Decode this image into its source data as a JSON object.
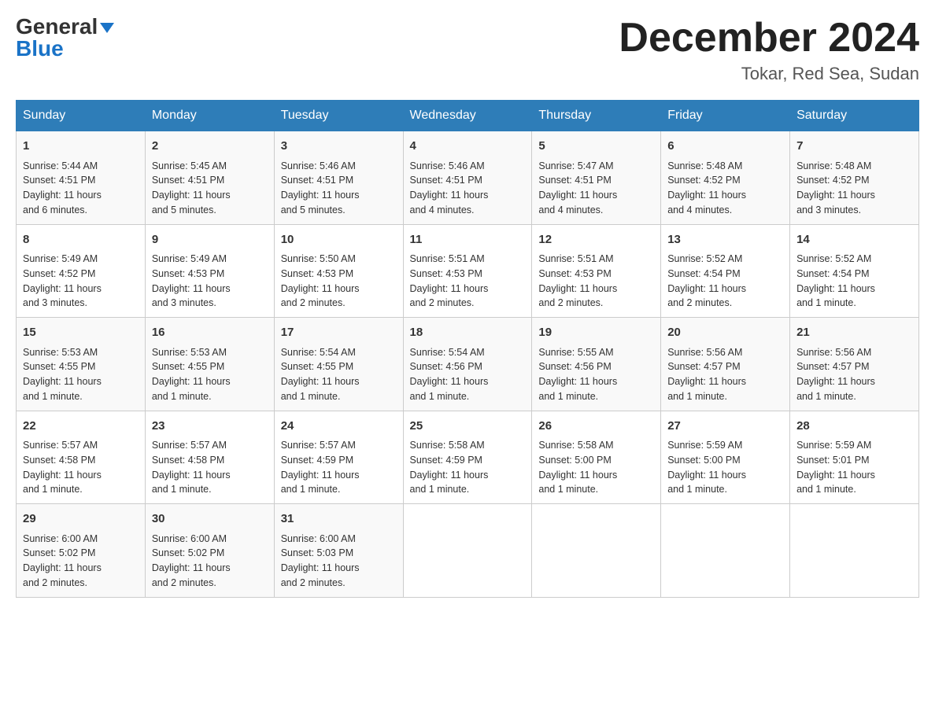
{
  "logo": {
    "general": "General",
    "blue": "Blue"
  },
  "title": {
    "month_year": "December 2024",
    "location": "Tokar, Red Sea, Sudan"
  },
  "headers": [
    "Sunday",
    "Monday",
    "Tuesday",
    "Wednesday",
    "Thursday",
    "Friday",
    "Saturday"
  ],
  "weeks": [
    [
      {
        "day": "1",
        "info": "Sunrise: 5:44 AM\nSunset: 4:51 PM\nDaylight: 11 hours\nand 6 minutes."
      },
      {
        "day": "2",
        "info": "Sunrise: 5:45 AM\nSunset: 4:51 PM\nDaylight: 11 hours\nand 5 minutes."
      },
      {
        "day": "3",
        "info": "Sunrise: 5:46 AM\nSunset: 4:51 PM\nDaylight: 11 hours\nand 5 minutes."
      },
      {
        "day": "4",
        "info": "Sunrise: 5:46 AM\nSunset: 4:51 PM\nDaylight: 11 hours\nand 4 minutes."
      },
      {
        "day": "5",
        "info": "Sunrise: 5:47 AM\nSunset: 4:51 PM\nDaylight: 11 hours\nand 4 minutes."
      },
      {
        "day": "6",
        "info": "Sunrise: 5:48 AM\nSunset: 4:52 PM\nDaylight: 11 hours\nand 4 minutes."
      },
      {
        "day": "7",
        "info": "Sunrise: 5:48 AM\nSunset: 4:52 PM\nDaylight: 11 hours\nand 3 minutes."
      }
    ],
    [
      {
        "day": "8",
        "info": "Sunrise: 5:49 AM\nSunset: 4:52 PM\nDaylight: 11 hours\nand 3 minutes."
      },
      {
        "day": "9",
        "info": "Sunrise: 5:49 AM\nSunset: 4:53 PM\nDaylight: 11 hours\nand 3 minutes."
      },
      {
        "day": "10",
        "info": "Sunrise: 5:50 AM\nSunset: 4:53 PM\nDaylight: 11 hours\nand 2 minutes."
      },
      {
        "day": "11",
        "info": "Sunrise: 5:51 AM\nSunset: 4:53 PM\nDaylight: 11 hours\nand 2 minutes."
      },
      {
        "day": "12",
        "info": "Sunrise: 5:51 AM\nSunset: 4:53 PM\nDaylight: 11 hours\nand 2 minutes."
      },
      {
        "day": "13",
        "info": "Sunrise: 5:52 AM\nSunset: 4:54 PM\nDaylight: 11 hours\nand 2 minutes."
      },
      {
        "day": "14",
        "info": "Sunrise: 5:52 AM\nSunset: 4:54 PM\nDaylight: 11 hours\nand 1 minute."
      }
    ],
    [
      {
        "day": "15",
        "info": "Sunrise: 5:53 AM\nSunset: 4:55 PM\nDaylight: 11 hours\nand 1 minute."
      },
      {
        "day": "16",
        "info": "Sunrise: 5:53 AM\nSunset: 4:55 PM\nDaylight: 11 hours\nand 1 minute."
      },
      {
        "day": "17",
        "info": "Sunrise: 5:54 AM\nSunset: 4:55 PM\nDaylight: 11 hours\nand 1 minute."
      },
      {
        "day": "18",
        "info": "Sunrise: 5:54 AM\nSunset: 4:56 PM\nDaylight: 11 hours\nand 1 minute."
      },
      {
        "day": "19",
        "info": "Sunrise: 5:55 AM\nSunset: 4:56 PM\nDaylight: 11 hours\nand 1 minute."
      },
      {
        "day": "20",
        "info": "Sunrise: 5:56 AM\nSunset: 4:57 PM\nDaylight: 11 hours\nand 1 minute."
      },
      {
        "day": "21",
        "info": "Sunrise: 5:56 AM\nSunset: 4:57 PM\nDaylight: 11 hours\nand 1 minute."
      }
    ],
    [
      {
        "day": "22",
        "info": "Sunrise: 5:57 AM\nSunset: 4:58 PM\nDaylight: 11 hours\nand 1 minute."
      },
      {
        "day": "23",
        "info": "Sunrise: 5:57 AM\nSunset: 4:58 PM\nDaylight: 11 hours\nand 1 minute."
      },
      {
        "day": "24",
        "info": "Sunrise: 5:57 AM\nSunset: 4:59 PM\nDaylight: 11 hours\nand 1 minute."
      },
      {
        "day": "25",
        "info": "Sunrise: 5:58 AM\nSunset: 4:59 PM\nDaylight: 11 hours\nand 1 minute."
      },
      {
        "day": "26",
        "info": "Sunrise: 5:58 AM\nSunset: 5:00 PM\nDaylight: 11 hours\nand 1 minute."
      },
      {
        "day": "27",
        "info": "Sunrise: 5:59 AM\nSunset: 5:00 PM\nDaylight: 11 hours\nand 1 minute."
      },
      {
        "day": "28",
        "info": "Sunrise: 5:59 AM\nSunset: 5:01 PM\nDaylight: 11 hours\nand 1 minute."
      }
    ],
    [
      {
        "day": "29",
        "info": "Sunrise: 6:00 AM\nSunset: 5:02 PM\nDaylight: 11 hours\nand 2 minutes."
      },
      {
        "day": "30",
        "info": "Sunrise: 6:00 AM\nSunset: 5:02 PM\nDaylight: 11 hours\nand 2 minutes."
      },
      {
        "day": "31",
        "info": "Sunrise: 6:00 AM\nSunset: 5:03 PM\nDaylight: 11 hours\nand 2 minutes."
      },
      null,
      null,
      null,
      null
    ]
  ]
}
